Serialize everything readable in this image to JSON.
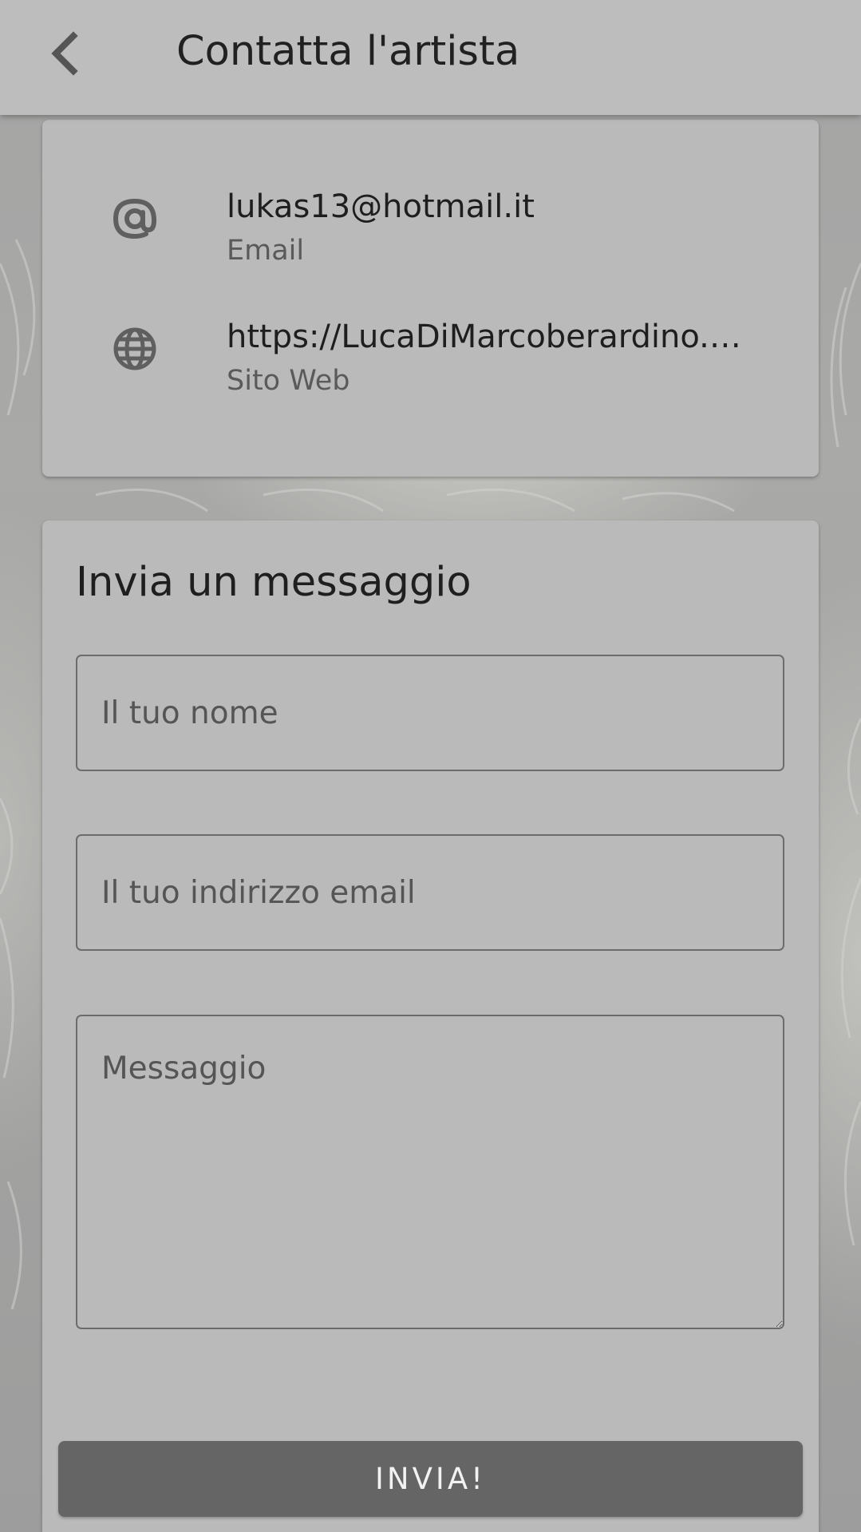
{
  "appbar": {
    "title": "Contatta l'artista",
    "back_icon": "chevron-left-icon"
  },
  "contact": {
    "items": [
      {
        "icon": "at-icon",
        "value": "lukas13@hotmail.it",
        "label": "Email"
      },
      {
        "icon": "globe-icon",
        "value": "https://LucaDiMarcoberardino.…",
        "label": "Sito Web"
      }
    ]
  },
  "form": {
    "title": "Invia un messaggio",
    "name_placeholder": "Il tuo nome",
    "email_placeholder": "Il tuo indirizzo email",
    "message_placeholder": "Messaggio",
    "submit_label": "INVIA!"
  },
  "colors": {
    "appbar": "#bdbdbd",
    "card": "#bababa",
    "button": "#656565",
    "button_text": "#f2f2f2",
    "icon": "#5f5f5f"
  }
}
